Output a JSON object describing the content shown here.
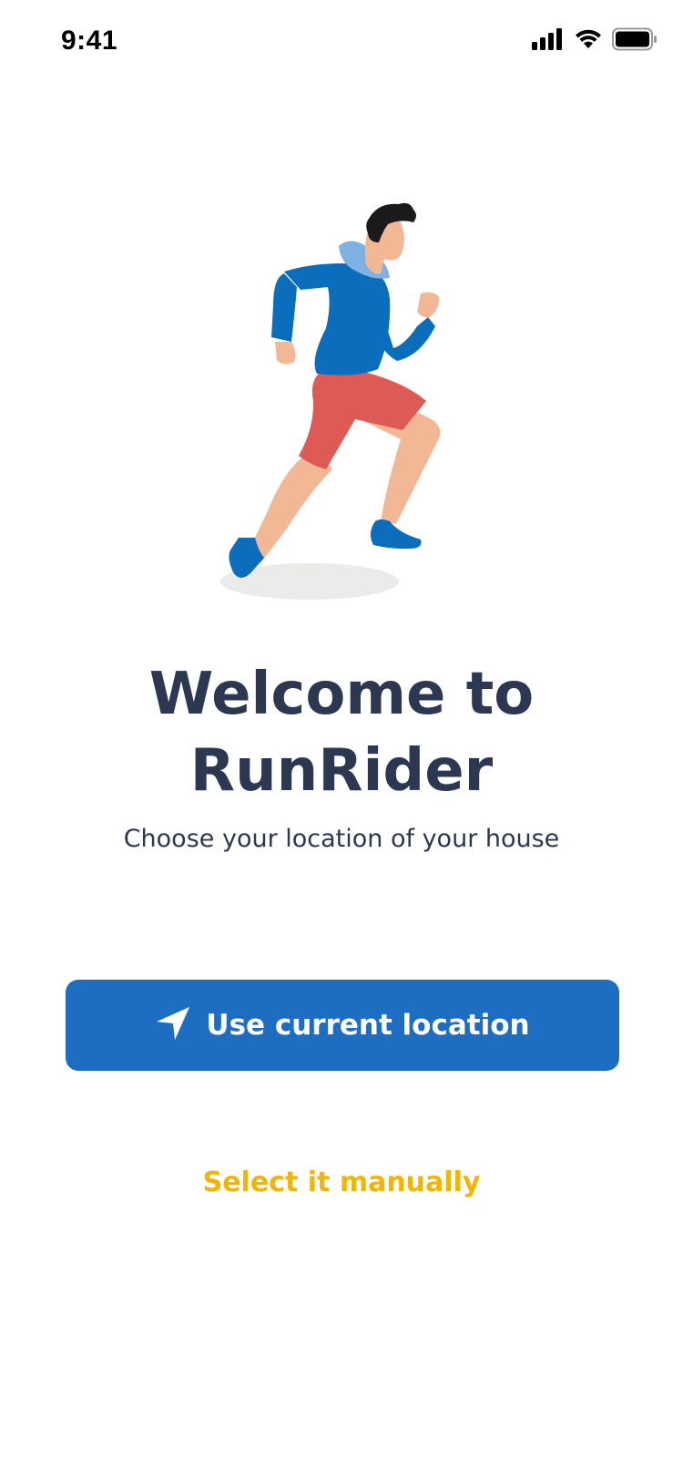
{
  "status_bar": {
    "time": "9:41",
    "icons": [
      "cellular-signal-icon",
      "wifi-icon",
      "battery-icon"
    ]
  },
  "illustration": {
    "name": "runner-illustration",
    "colors": {
      "hoodie": "#0b6ebd",
      "hood": "#7fb1e2",
      "shorts": "#dd5a55",
      "skin": "#f2b896",
      "hair": "#1a1a1a",
      "shoes": "#0b6ebd",
      "shadow": "#ebebe9"
    }
  },
  "welcome": {
    "title_line1": "Welcome to",
    "title_line2": "RunRider",
    "subtitle": "Choose your location of your house"
  },
  "actions": {
    "primary_label": "Use current location",
    "primary_icon": "location-arrow-icon",
    "secondary_label": "Select it manually"
  },
  "colors": {
    "primary": "#1d6dc3",
    "accent": "#f4b400",
    "text": "#2c3751"
  }
}
